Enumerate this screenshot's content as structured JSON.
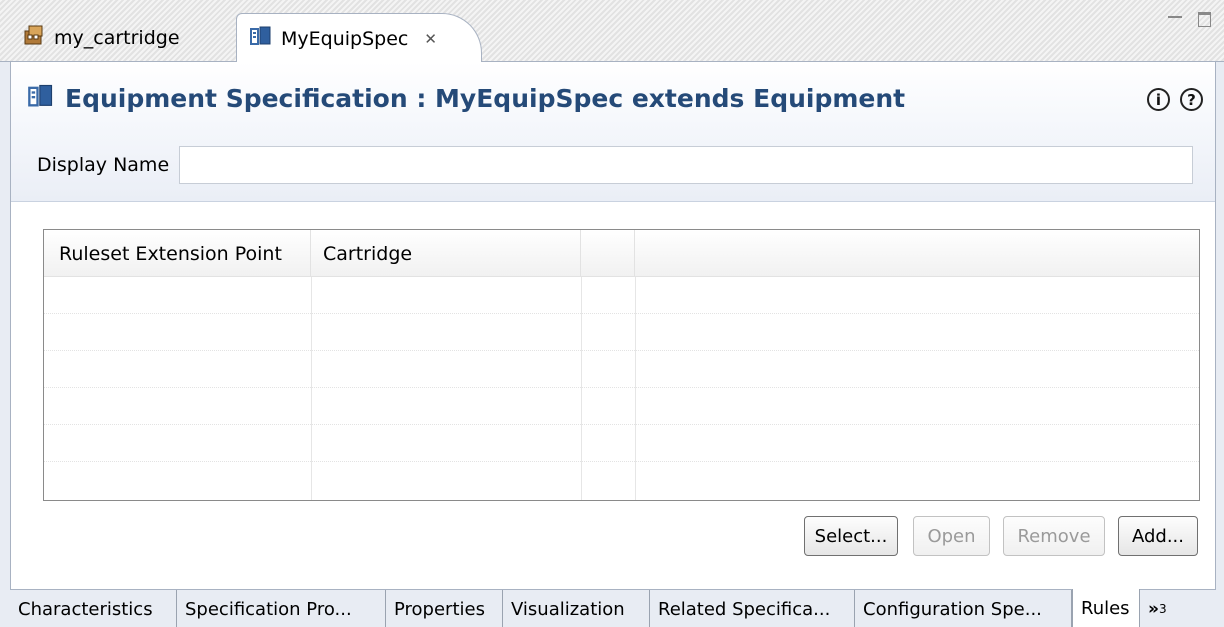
{
  "editor_tabs": [
    {
      "label": "my_cartridge",
      "icon": "cartridge-icon"
    },
    {
      "label": "MyEquipSpec",
      "icon": "equipment-spec-icon",
      "close": "✕"
    }
  ],
  "header": {
    "title": "Equipment Specification : MyEquipSpec extends Equipment",
    "title_color": "#254a78",
    "info_icon": "i",
    "help_icon": "?"
  },
  "display_name": {
    "label": "Display Name",
    "value": ""
  },
  "table": {
    "columns": [
      "Ruleset Extension Point",
      "Cartridge",
      "",
      ""
    ],
    "rows": []
  },
  "buttons": {
    "select": "Select...",
    "open": "Open",
    "remove": "Remove",
    "add": "Add..."
  },
  "page_tabs": [
    "Characteristics",
    "Specification Pro...",
    "Properties",
    "Visualization",
    "Related Specifica...",
    "Configuration Spe...",
    "Rules"
  ],
  "overflow": {
    "chevron": "»",
    "count": "3"
  }
}
